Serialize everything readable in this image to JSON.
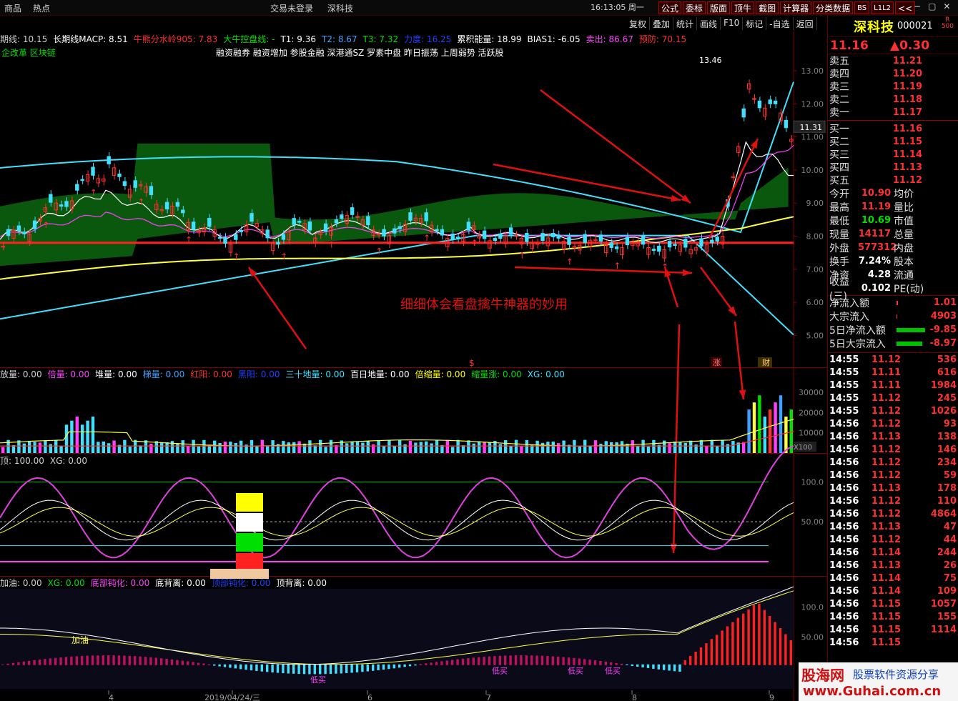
{
  "topbar": {
    "menu": [
      "商品",
      "热点"
    ],
    "login_status": "交易未登录",
    "stock_title": "深科技",
    "clock": "16:13:05 周一",
    "tools": [
      "公式",
      "委标",
      "版面",
      "顶牛",
      "截图",
      "计算器",
      "分类数据",
      "BS",
      "L1L2",
      "<<"
    ],
    "window_controls": [
      "−",
      "▢",
      "✕"
    ]
  },
  "chart_menu": [
    "复权",
    "叠加",
    "统计",
    "画线",
    "F10",
    "标记",
    "-自选",
    "返回"
  ],
  "main_indicators": {
    "items": [
      {
        "label": "期线: 10.15",
        "color": "#d0d0d0"
      },
      {
        "label": "长期线MACP: 8.51",
        "color": "#ffffff"
      },
      {
        "label": "牛熊分水岭905: 7.83",
        "color": "#ff3030"
      },
      {
        "label": "大牛控盘线: -",
        "color": "#00e000"
      },
      {
        "label": "T1: 9.36",
        "color": "#ffffff"
      },
      {
        "label": "T2: 8.67",
        "color": "#40a0ff"
      },
      {
        "label": "T3: 7.32",
        "color": "#00e000"
      },
      {
        "label": "力度: 16.25",
        "color": "#2040ff"
      },
      {
        "label": "累积能量: 18.99",
        "color": "#ffffff"
      },
      {
        "label": "BIAS1: -6.05",
        "color": "#ffffff"
      },
      {
        "label": "卖出: 86.67",
        "color": "#ff40ff"
      },
      {
        "label": "预防: 70.15",
        "color": "#ff3030"
      }
    ],
    "concept_left": "企改革 区块链",
    "concepts": "融资融券 融资增加 参股金融 深港通SZ 罗素中盘 昨日振荡 上周弱势 活跃股"
  },
  "price_axis": [
    "13.00",
    "12.00",
    "11.00",
    "10.00",
    "9.00",
    "8.00",
    "7.00",
    "6.00",
    "5.00"
  ],
  "current_price_tag": "11.31",
  "high_label": "13.46",
  "annotation": "细细体会看盘擒牛神器的妙用",
  "event_markers": [
    "$",
    "涨",
    "财"
  ],
  "volume_indicators": [
    {
      "label": "放量: 0.00",
      "color": "#d0d0d0"
    },
    {
      "label": "倍量: 0.00",
      "color": "#ff40ff"
    },
    {
      "label": "堆量: 0.00",
      "color": "#ffffff"
    },
    {
      "label": "梯量: 0.00",
      "color": "#40a0ff"
    },
    {
      "label": "红阳: 0.00",
      "color": "#ff3030"
    },
    {
      "label": "黑阳: 0.00",
      "color": "#2040ff"
    },
    {
      "label": "三十地量: 0.00",
      "color": "#40e0ff"
    },
    {
      "label": "百日地量: 0.00",
      "color": "#ffffff"
    },
    {
      "label": "倍缩量: 0.00",
      "color": "#ffff00"
    },
    {
      "label": "缩量涨: 0.00",
      "color": "#00e000"
    },
    {
      "label": "XG: 0.00",
      "color": "#40e0ff"
    }
  ],
  "volume_axis": [
    "30000",
    "20000",
    "10000",
    "X100"
  ],
  "kdj_indicators": [
    {
      "label": "顶: 100.00",
      "color": "#d0d0d0"
    },
    {
      "label": "XG: 0.00",
      "color": "#d0d0d0"
    }
  ],
  "kdj_axis": [
    "100.0",
    "50.00"
  ],
  "macd_indicators": [
    {
      "label": "加油: 0.00",
      "color": "#d0d0d0"
    },
    {
      "label": "XG: 0.00",
      "color": "#00e000"
    },
    {
      "label": "底部钝化: 0.00",
      "color": "#ff40ff"
    },
    {
      "label": "底背离: 0.00",
      "color": "#ffffff"
    },
    {
      "label": "顶部钝化: 0.00",
      "color": "#2040ff"
    },
    {
      "label": "顶背离: 0.00",
      "color": "#ffffff"
    }
  ],
  "macd_axis": [
    "100.0",
    "50.00"
  ],
  "macd_labels": [
    "加油",
    "低买",
    "低买",
    "低买",
    "低买"
  ],
  "date_axis": [
    "4",
    "2019/04/24/三",
    "6",
    "7",
    "8",
    "9"
  ],
  "stock": {
    "name": "深科技",
    "code": "000021",
    "badge_top": "R",
    "badge_bottom": "500",
    "price": "11.16",
    "change": "▲0.30"
  },
  "orderbook": {
    "asks": [
      {
        "label": "卖五",
        "price": "11.21"
      },
      {
        "label": "卖四",
        "price": "11.20"
      },
      {
        "label": "卖三",
        "price": "11.19"
      },
      {
        "label": "卖二",
        "price": "11.18"
      },
      {
        "label": "卖一",
        "price": "11.17"
      }
    ],
    "bids": [
      {
        "label": "买一",
        "price": "11.16"
      },
      {
        "label": "买二",
        "price": "11.15"
      },
      {
        "label": "买三",
        "price": "11.14"
      },
      {
        "label": "买四",
        "price": "11.13"
      },
      {
        "label": "买五",
        "price": "11.12"
      }
    ]
  },
  "stats": [
    {
      "l1": "今开",
      "v1": "10.90",
      "c1": "red",
      "l2": "均价",
      "v2": ""
    },
    {
      "l1": "最高",
      "v1": "11.19",
      "c1": "red",
      "l2": "量比",
      "v2": ""
    },
    {
      "l1": "最低",
      "v1": "10.69",
      "c1": "green",
      "l2": "市值",
      "v2": ""
    },
    {
      "l1": "现量",
      "v1": "14117",
      "c1": "red",
      "l2": "总量",
      "v2": ""
    },
    {
      "l1": "外盘",
      "v1": "577312",
      "c1": "red",
      "l2": "内盘",
      "v2": ""
    },
    {
      "l1": "换手",
      "v1": "7.24%",
      "c1": "white",
      "l2": "股本",
      "v2": ""
    },
    {
      "l1": "净资",
      "v1": "4.28",
      "c1": "white",
      "l2": "流通",
      "v2": ""
    },
    {
      "l1": "收益(三)",
      "v1": "0.102",
      "c1": "white",
      "l2": "PE(动)",
      "v2": ""
    }
  ],
  "flows": [
    {
      "label": "净流入额",
      "value": "1.01",
      "color": "red",
      "bar": 2
    },
    {
      "label": "大宗流入",
      "value": "4903",
      "color": "red",
      "bar": 1
    },
    {
      "label": "5日净流入额",
      "value": "-9.85",
      "color": "red",
      "bar": 40
    },
    {
      "label": "5日大宗流入",
      "value": "-8.97",
      "color": "red",
      "bar": 36
    }
  ],
  "ticks": [
    {
      "time": "14:55",
      "price": "11.12",
      "vol": "536"
    },
    {
      "time": "14:55",
      "price": "11.11",
      "vol": "616"
    },
    {
      "time": "14:55",
      "price": "11.11",
      "vol": "1984"
    },
    {
      "time": "14:55",
      "price": "11.12",
      "vol": "245"
    },
    {
      "time": "14:55",
      "price": "11.12",
      "vol": "1026"
    },
    {
      "time": "14:56",
      "price": "11.12",
      "vol": "93"
    },
    {
      "time": "14:56",
      "price": "11.13",
      "vol": "138"
    },
    {
      "time": "14:56",
      "price": "11.12",
      "vol": "146"
    },
    {
      "time": "14:56",
      "price": "11.12",
      "vol": "234"
    },
    {
      "time": "14:56",
      "price": "11.12",
      "vol": "59"
    },
    {
      "time": "14:56",
      "price": "11.13",
      "vol": "178"
    },
    {
      "time": "14:56",
      "price": "11.12",
      "vol": "110"
    },
    {
      "time": "14:56",
      "price": "11.12",
      "vol": "4864"
    },
    {
      "time": "14:56",
      "price": "11.13",
      "vol": "47"
    },
    {
      "time": "14:56",
      "price": "11.12",
      "vol": "44"
    },
    {
      "time": "14:56",
      "price": "11.14",
      "vol": "244"
    },
    {
      "time": "14:56",
      "price": "11.13",
      "vol": "26"
    },
    {
      "time": "14:56",
      "price": "11.14",
      "vol": "75"
    },
    {
      "time": "14:56",
      "price": "11.14",
      "vol": "109"
    },
    {
      "time": "14:56",
      "price": "11.15",
      "vol": "1057"
    },
    {
      "time": "14:56",
      "price": "11.15",
      "vol": "155"
    },
    {
      "time": "14:56",
      "price": "11.15",
      "vol": "1114"
    },
    {
      "time": "14:56",
      "price": "11.15",
      "vol": ""
    }
  ],
  "watermark": {
    "name": "股海网",
    "slogan": "股票软件资源分享",
    "url": "www.Guhai.com.cn"
  }
}
